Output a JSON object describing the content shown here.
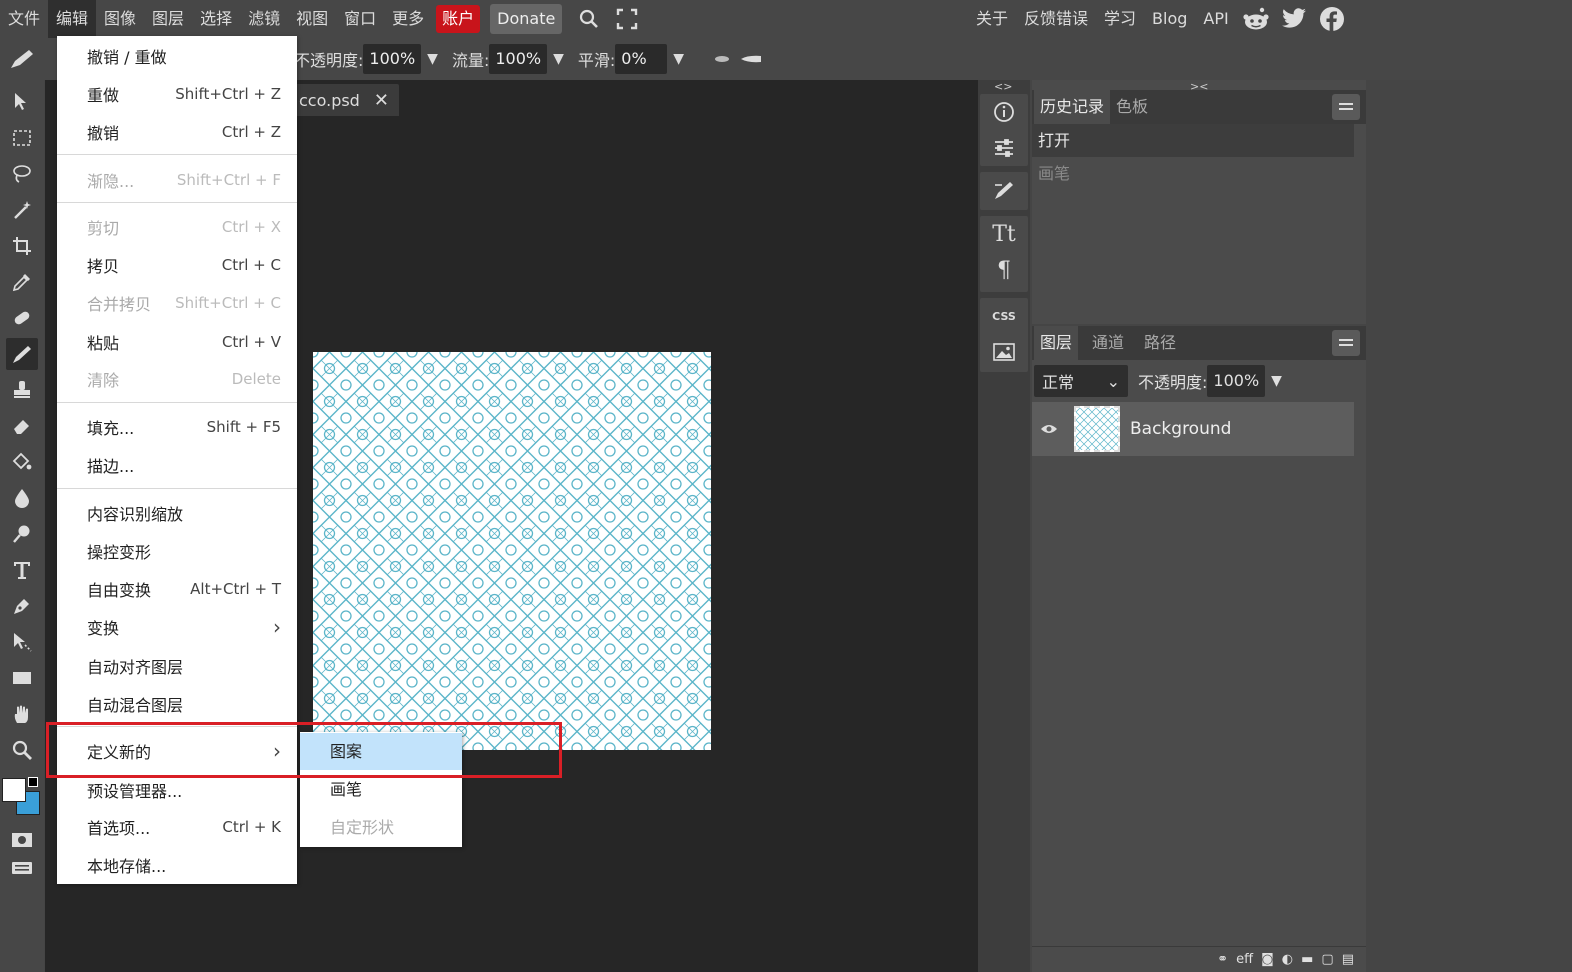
{
  "menubar": {
    "items": [
      "文件",
      "编辑",
      "图像",
      "图层",
      "选择",
      "滤镜",
      "视图",
      "窗口",
      "更多"
    ],
    "account": "账户",
    "donate": "Donate",
    "right_links": [
      "关于",
      "反馈错误",
      "学习",
      "Blog",
      "API"
    ],
    "social_icons": [
      "reddit-icon",
      "twitter-icon",
      "facebook-icon"
    ]
  },
  "options": {
    "opacity_label": "不透明度:",
    "opacity_value": "100%",
    "flow_label": "流量:",
    "flow_value": "100%",
    "smooth_label": "平滑:",
    "smooth_value": "0%"
  },
  "document": {
    "tab_title": "cco.psd"
  },
  "edit_menu": {
    "items": [
      {
        "label": "撤销 / 重做",
        "shortcut": ""
      },
      {
        "label": "重做",
        "shortcut": "Shift+Ctrl + Z"
      },
      {
        "label": "撤销",
        "shortcut": "Ctrl + Z"
      },
      {
        "label": "渐隐...",
        "shortcut": "Shift+Ctrl + F"
      },
      {
        "label": "剪切",
        "shortcut": "Ctrl + X"
      },
      {
        "label": "拷贝",
        "shortcut": "Ctrl + C"
      },
      {
        "label": "合并拷贝",
        "shortcut": "Shift+Ctrl + C"
      },
      {
        "label": "粘贴",
        "shortcut": "Ctrl + V"
      },
      {
        "label": "清除",
        "shortcut": "Delete"
      },
      {
        "label": "填充...",
        "shortcut": "Shift + F5"
      },
      {
        "label": "描边...",
        "shortcut": ""
      },
      {
        "label": "内容识别缩放",
        "shortcut": ""
      },
      {
        "label": "操控变形",
        "shortcut": ""
      },
      {
        "label": "自由变换",
        "shortcut": "Alt+Ctrl + T"
      },
      {
        "label": "变换",
        "shortcut": "›"
      },
      {
        "label": "自动对齐图层",
        "shortcut": ""
      },
      {
        "label": "自动混合图层",
        "shortcut": ""
      },
      {
        "label": "定义新的",
        "shortcut": "›"
      },
      {
        "label": "预设管理器...",
        "shortcut": ""
      },
      {
        "label": "首选项...",
        "shortcut": "Ctrl + K"
      },
      {
        "label": "本地存储...",
        "shortcut": ""
      }
    ]
  },
  "define_new_submenu": {
    "items": [
      "图案",
      "画笔",
      "自定形状"
    ],
    "highlighted": "图案"
  },
  "history_panel": {
    "tabs": [
      "历史记录",
      "色板"
    ],
    "rows": [
      "打开",
      "画笔"
    ]
  },
  "layers_panel": {
    "tabs": [
      "图层",
      "通道",
      "路径"
    ],
    "blend_mode": "正常",
    "opacity_label": "不透明度:",
    "opacity_value": "100%",
    "layer_name": "Background",
    "footer_text": "eff"
  },
  "colors": {
    "accent_red": "#d91f26",
    "account_red": "#c8141b",
    "pattern": "#5bb5c9",
    "background_color_swatch": "#3a9fd8",
    "foreground_color_swatch": "#ffffff"
  }
}
